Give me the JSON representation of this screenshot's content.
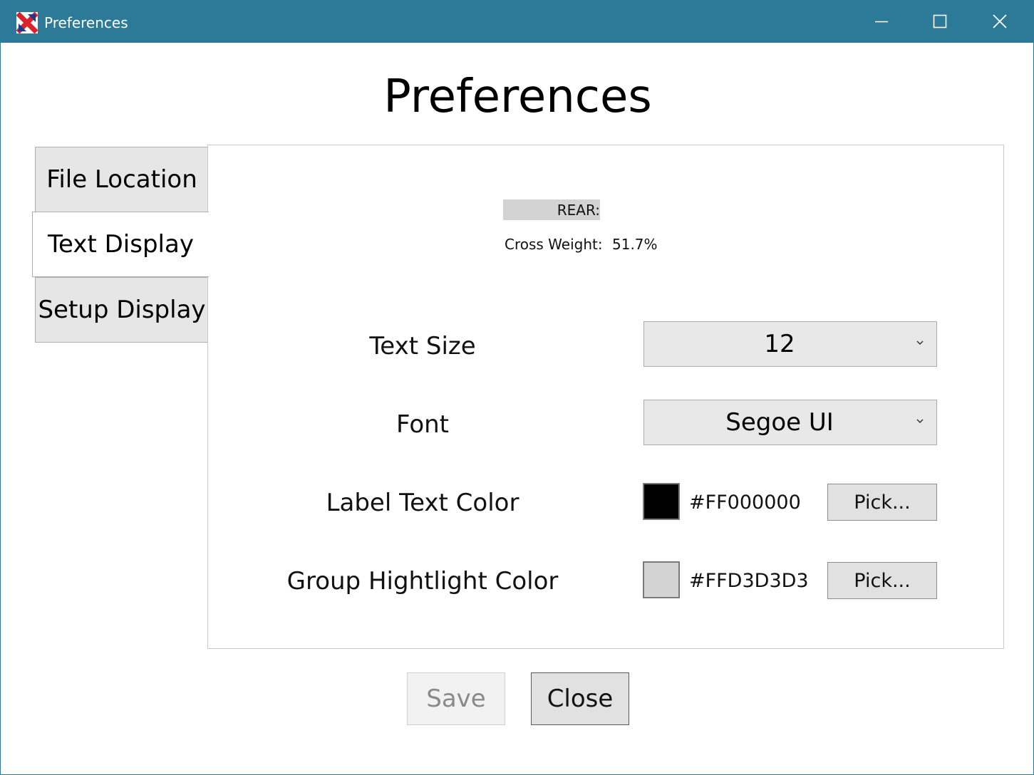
{
  "window": {
    "title": "Preferences",
    "controls": {
      "minimize": "minimize-icon",
      "maximize": "maximize-icon",
      "close": "close-icon"
    },
    "accent_color": "#2C7A98"
  },
  "heading": "Preferences",
  "tabs": [
    {
      "label": "File Location",
      "selected": false
    },
    {
      "label": "Text Display",
      "selected": true
    },
    {
      "label": "Setup Display",
      "selected": false
    }
  ],
  "preview": {
    "rear_label": "REAR:",
    "cross_weight_label": "Cross Weight:",
    "cross_weight_value": "51.7%"
  },
  "fields": {
    "text_size": {
      "label": "Text Size",
      "value": "12"
    },
    "font": {
      "label": "Font",
      "value": "Segoe UI"
    },
    "label_text_color": {
      "label": "Label Text Color",
      "value": "#FF000000",
      "swatch": "#000000",
      "button": "Pick..."
    },
    "group_highlight_color": {
      "label": "Group Hightlight Color",
      "value": "#FFD3D3D3",
      "swatch": "#D3D3D3",
      "button": "Pick..."
    }
  },
  "buttons": {
    "save": "Save",
    "close": "Close"
  }
}
